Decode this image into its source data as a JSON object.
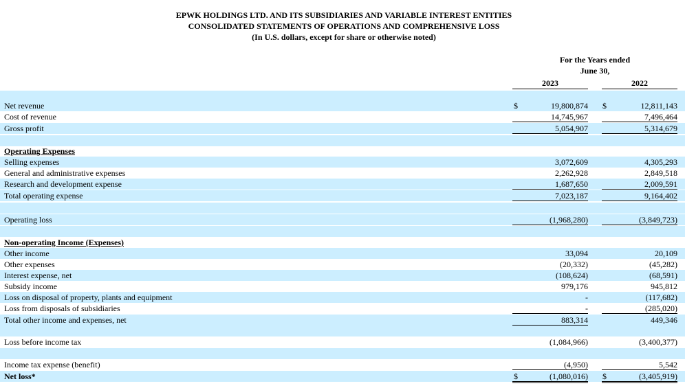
{
  "header": {
    "line1": "EPWK HOLDINGS LTD. AND ITS SUBSIDIARIES AND VARIABLE INTEREST ENTITIES",
    "line2": "CONSOLIDATED STATEMENTS OF OPERATIONS AND COMPREHENSIVE LOSS",
    "line3": "(In U.S. dollars, except for share or otherwise noted)"
  },
  "columns": {
    "period_line1": "For the Years ended",
    "period_line2": "June 30,",
    "year1": "2023",
    "year2": "2022",
    "currency": "$"
  },
  "rows": [
    {
      "label": "Net revenue",
      "v2023": "19,800,874",
      "v2022": "12,811,143"
    },
    {
      "label": "Cost of revenue",
      "v2023": "14,745,967",
      "v2022": "7,496,464"
    },
    {
      "label": "Gross profit",
      "v2023": "5,054,907",
      "v2022": "5,314,679"
    },
    {
      "label": "Operating Expenses",
      "v2023": "",
      "v2022": ""
    },
    {
      "label": "Selling expenses",
      "v2023": "3,072,609",
      "v2022": "4,305,293"
    },
    {
      "label": "General and administrative expenses",
      "v2023": "2,262,928",
      "v2022": "2,849,518"
    },
    {
      "label": "Research and development expense",
      "v2023": "1,687,650",
      "v2022": "2,009,591"
    },
    {
      "label": "Total operating expense",
      "v2023": "7,023,187",
      "v2022": "9,164,402"
    },
    {
      "label": "Operating loss",
      "v2023": "(1,968,280)",
      "v2022": "(3,849,723)"
    },
    {
      "label": "Non-operating Income (Expenses)",
      "v2023": "",
      "v2022": ""
    },
    {
      "label": "Other income",
      "v2023": "33,094",
      "v2022": "20,109"
    },
    {
      "label": "Other expenses",
      "v2023": "(20,332)",
      "v2022": "(45,282)"
    },
    {
      "label": "Interest expense, net",
      "v2023": "(108,624)",
      "v2022": "(68,591)"
    },
    {
      "label": "Subsidy income",
      "v2023": "979,176",
      "v2022": "945,812"
    },
    {
      "label": "Loss on disposal of property, plants and equipment",
      "v2023": "-",
      "v2022": "(117,682)"
    },
    {
      "label": "Loss from disposals of subsidiaries",
      "v2023": "-",
      "v2022": "(285,020)"
    },
    {
      "label": "Total other income and expenses, net",
      "v2023": "883,314",
      "v2022": "449,346"
    },
    {
      "label": "Loss before income tax",
      "v2023": "(1,084,966)",
      "v2022": "(3,400,377)"
    },
    {
      "label": "Income tax expense (benefit)",
      "v2023": "(4,950)",
      "v2022": "5,542"
    },
    {
      "label": "Net loss*",
      "v2023": "(1,080,016)",
      "v2022": "(3,405,919)"
    }
  ]
}
